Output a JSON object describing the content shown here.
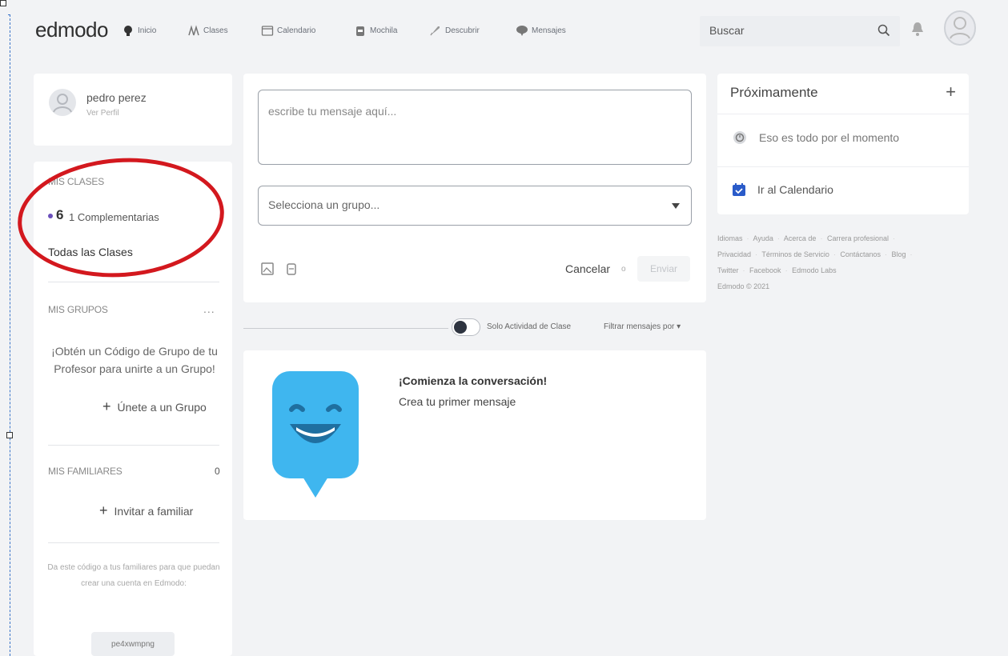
{
  "nav": {
    "logo": "edmodo",
    "items": [
      {
        "label": "Inicio",
        "icon": "home-icon"
      },
      {
        "label": "Clases",
        "icon": "classes-icon"
      },
      {
        "label": "Calendario",
        "icon": "calendar-icon"
      },
      {
        "label": "Mochila",
        "icon": "backpack-icon"
      },
      {
        "label": "Descubrir",
        "icon": "rocket-icon"
      },
      {
        "label": "Mensajes",
        "icon": "chat-icon"
      }
    ],
    "search_text": "Buscar"
  },
  "profile": {
    "name": "pedro perez",
    "link": "Ver Perfil"
  },
  "sidebar": {
    "classes_title": "MIS CLASES",
    "class_count": "6",
    "class_name": "1 Complementarias",
    "all_classes": "Todas las Clases",
    "groups_title": "MIS GRUPOS",
    "groups_menu": "...",
    "groups_promo": "¡Obtén un Código de Grupo de tu Profesor para unirte a un Grupo!",
    "join_group": "Únete a un Grupo",
    "family_title": "MIS FAMILIARES",
    "family_count": "0",
    "invite_family": "Invitar a familiar",
    "family_note": "Da este código a tus familiares para que puedan crear una cuenta en Edmodo:",
    "family_code": "pe4xwmpng"
  },
  "composer": {
    "message_placeholder": "escribe tu mensaje aquí...",
    "group_placeholder": "Selecciona un grupo...",
    "cancel": "Cancelar",
    "or": "o",
    "send": "Enviar"
  },
  "filters": {
    "toggle_label": "Solo Actividad de Clase",
    "filter_label": "Filtrar mensajes por"
  },
  "empty_state": {
    "title": "¡Comienza la conversación!",
    "subtitle": "Crea tu primer mensaje"
  },
  "upcoming": {
    "title": "Próximamente",
    "empty": "Eso es todo por el momento",
    "calendar_link": "Ir al Calendario"
  },
  "footer": {
    "links": [
      "Idiomas",
      "Ayuda",
      "Acerca de",
      "Carrera profesional",
      "Privacidad",
      "Términos de Servicio",
      "Contáctanos",
      "Blog",
      "Twitter",
      "Facebook",
      "Edmodo Labs"
    ],
    "copyright": "Edmodo © 2021"
  },
  "colors": {
    "accent_purple": "#6b4fbb",
    "annotation_red": "#d3181e",
    "mascot_blue": "#3fb6ef",
    "calendar_blue": "#2a5bc9"
  }
}
